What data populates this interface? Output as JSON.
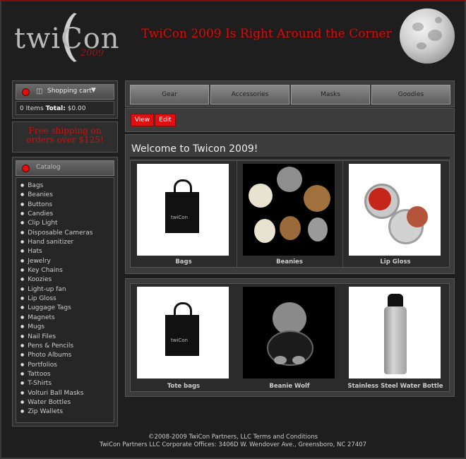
{
  "header": {
    "logo_text": "twiCon",
    "logo_year": "2009",
    "tagline": "TwiCon 2009 Is Right Around the Corner"
  },
  "cart": {
    "title": "Shopping cart",
    "items_label": "0 Items",
    "total_label": "Total:",
    "total_value": "$0.00"
  },
  "promo": {
    "text": "Free shipping on orders over $125!"
  },
  "catalog": {
    "title": "Catalog",
    "items": [
      "Bags",
      "Beanies",
      "Buttons",
      "Candies",
      "Clip Light",
      "Disposable Cameras",
      "Hand sanitizer",
      "Hats",
      "Jewelry",
      "Key Chains",
      "Koozies",
      "Light-up fan",
      "Lip Gloss",
      "Luggage Tags",
      "Magnets",
      "Mugs",
      "Nail Files",
      "Pens & Pencils",
      "Photo Albums",
      "Portfolios",
      "Tattoos",
      "T-Shirts",
      "Volturi Ball Masks",
      "Water Bottles",
      "Zip Wallets"
    ]
  },
  "nav": {
    "tabs": [
      "Gear",
      "Accessories",
      "Masks",
      "Goodies"
    ]
  },
  "actions": {
    "view": "View",
    "edit": "Edit"
  },
  "welcome": {
    "title": "Welcome to Twicon 2009!",
    "items": [
      "Bags",
      "Beanies",
      "Lip Gloss"
    ]
  },
  "products": {
    "items": [
      "Tote bags",
      "Beanie Wolf",
      "Stainless Steel Water Bottle"
    ]
  },
  "footer": {
    "line1": "©2008-2009 TwiCon Partners, LLC Terms and Conditions",
    "line2": "TwiCon Partners LLC Corporate Offices: 3406D W. Wendover Ave., Greensboro, NC 27407"
  },
  "colors": {
    "accent": "#c41414",
    "panel": "#3c3c3c",
    "background": "#1e1e1e"
  }
}
